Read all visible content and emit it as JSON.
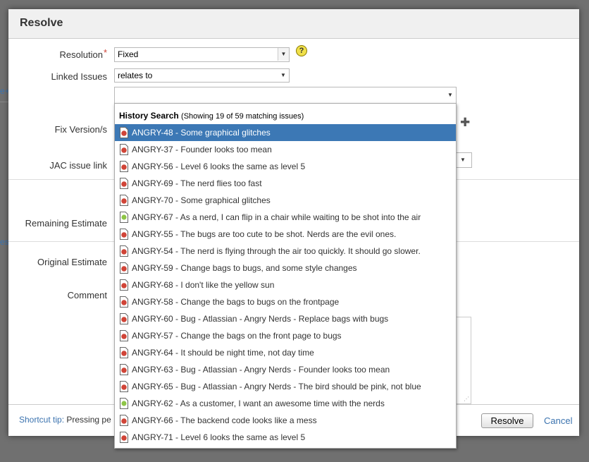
{
  "background": {
    "fragments": [
      "e+",
      "es"
    ]
  },
  "dialog": {
    "title": "Resolve",
    "fields": {
      "resolution": {
        "label": "Resolution",
        "required_mark": "*",
        "value": "Fixed"
      },
      "linked_issues": {
        "label": "Linked Issues",
        "value": "relates to",
        "issue_value": ""
      },
      "fix_versions": {
        "label": "Fix Version/s"
      },
      "jac_issue_link": {
        "label": "JAC issue link"
      },
      "remaining_estimate": {
        "label": "Remaining Estimate"
      },
      "original_estimate": {
        "label": "Original Estimate"
      },
      "comment": {
        "label": "Comment"
      }
    },
    "help_glyph": "?",
    "add_glyph": "✚",
    "footer": {
      "tip_label": "Shortcut tip:",
      "tip_text": "Pressing pe",
      "resolve_label": "Resolve",
      "cancel_label": "Cancel"
    }
  },
  "dropdown": {
    "heading": "History Search",
    "count_text": "(Showing 19 of 59 matching issues)",
    "items": [
      {
        "text": "ANGRY-48 - Some graphical glitches",
        "type": "bug",
        "selected": true
      },
      {
        "text": "ANGRY-37 - Founder looks too mean",
        "type": "bug"
      },
      {
        "text": "ANGRY-56 - Level 6 looks the same as level 5",
        "type": "bug"
      },
      {
        "text": "ANGRY-69 - The nerd flies too fast",
        "type": "bug"
      },
      {
        "text": "ANGRY-70 - Some graphical glitches",
        "type": "bug"
      },
      {
        "text": "ANGRY-67 - As a nerd, I can flip in a chair while waiting to be shot into the air",
        "type": "story"
      },
      {
        "text": "ANGRY-55 - The bugs are too cute to be shot. Nerds are the evil ones.",
        "type": "bug"
      },
      {
        "text": "ANGRY-54 - The nerd is flying through the air too quickly. It should go slower.",
        "type": "bug"
      },
      {
        "text": "ANGRY-59 - Change bags to bugs, and some style changes",
        "type": "bug"
      },
      {
        "text": "ANGRY-68 - I don't like the yellow sun",
        "type": "bug"
      },
      {
        "text": "ANGRY-58 - Change the bags to bugs on the frontpage",
        "type": "bug"
      },
      {
        "text": "ANGRY-60 - Bug - Atlassian - Angry Nerds - Replace bags with bugs",
        "type": "bug"
      },
      {
        "text": "ANGRY-57 - Change the bags on the front page to bugs",
        "type": "bug"
      },
      {
        "text": "ANGRY-64 - It should be night time, not day time",
        "type": "bug"
      },
      {
        "text": "ANGRY-63 - Bug - Atlassian - Angry Nerds - Founder looks too mean",
        "type": "bug"
      },
      {
        "text": "ANGRY-65 - Bug - Atlassian - Angry Nerds - The bird should be pink, not blue",
        "type": "bug"
      },
      {
        "text": "ANGRY-62 - As a customer, I want an awesome time with the nerds",
        "type": "story"
      },
      {
        "text": "ANGRY-66 - The backend code looks like a mess",
        "type": "bug"
      },
      {
        "text": "ANGRY-71 - Level 6 looks the same as level 5",
        "type": "bug"
      }
    ]
  },
  "colors": {
    "selected_row": "#3c78b5",
    "link": "#3b73af",
    "required": "#d04437",
    "bug_icon": "#d04437",
    "story_icon": "#8ec547"
  }
}
